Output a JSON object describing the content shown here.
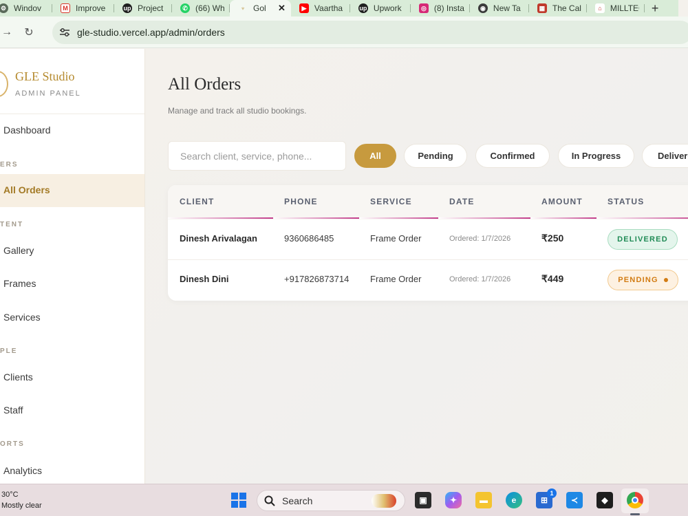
{
  "browser": {
    "tabs": [
      {
        "label": "Windov",
        "icon": "settings-icon",
        "color": "#5a6a5a"
      },
      {
        "label": "Improve",
        "icon": "gmail-icon",
        "color": "#d93025"
      },
      {
        "label": "Project",
        "icon": "upwork-icon",
        "color": "#1f1f1f"
      },
      {
        "label": "(66) Wh",
        "icon": "whatsapp-icon",
        "color": "#25d366"
      },
      {
        "label": "Gol",
        "icon": "studio-icon",
        "color": "#b58a2e",
        "active": true
      },
      {
        "label": "Vaartha",
        "icon": "youtube-icon",
        "color": "#ff0000"
      },
      {
        "label": "Upwork",
        "icon": "upwork-icon",
        "color": "#1f1f1f"
      },
      {
        "label": "(8) Insta",
        "icon": "instagram-icon",
        "color": "#d62976"
      },
      {
        "label": "New Ta",
        "icon": "chrome-icon",
        "color": "#3a3a3a"
      },
      {
        "label": "The Cal",
        "icon": "cal-icon",
        "color": "#c0392b"
      },
      {
        "label": "MILLTEC",
        "icon": "milltec-icon",
        "color": "#c0392b"
      }
    ],
    "url": "gle-studio.vercel.app/admin/orders"
  },
  "sidebar": {
    "brand_name": "GLE Studio",
    "brand_sub": "ADMIN PANEL",
    "items": {
      "dashboard": "Dashboard",
      "section_orders": "ERS",
      "all_orders": "All Orders",
      "section_content": "TENT",
      "gallery": "Gallery",
      "frames": "Frames",
      "services": "Services",
      "section_people": "PLE",
      "clients": "Clients",
      "staff": "Staff",
      "section_reports": "ORTS",
      "analytics": "Analytics"
    }
  },
  "main": {
    "title": "All Orders",
    "subtitle": "Manage and track all studio bookings.",
    "search_placeholder": "Search client, service, phone...",
    "filters": [
      "All",
      "Pending",
      "Confirmed",
      "In Progress",
      "Delivered"
    ],
    "active_filter": "All",
    "table": {
      "headers": [
        "CLIENT",
        "PHONE",
        "SERVICE",
        "DATE",
        "AMOUNT",
        "STATUS"
      ],
      "rows": [
        {
          "client": "Dinesh Arivalagan",
          "phone": "9360686485",
          "service": "Frame Order",
          "date": "Ordered: 1/7/2026",
          "amount": "₹250",
          "status": "DELIVERED"
        },
        {
          "client": "Dinesh Dini",
          "phone": "+917826873714",
          "service": "Frame Order",
          "date": "Ordered: 1/7/2026",
          "amount": "₹449",
          "status": "PENDING"
        }
      ]
    }
  },
  "taskbar": {
    "temperature": "30°C",
    "weather": "Mostly clear",
    "search_label": "Search",
    "notification_badge": "1"
  },
  "colors": {
    "accent": "#c79a3e",
    "brand": "#b58a2e",
    "delivered": "#1f8a55",
    "pending": "#d27b12"
  }
}
